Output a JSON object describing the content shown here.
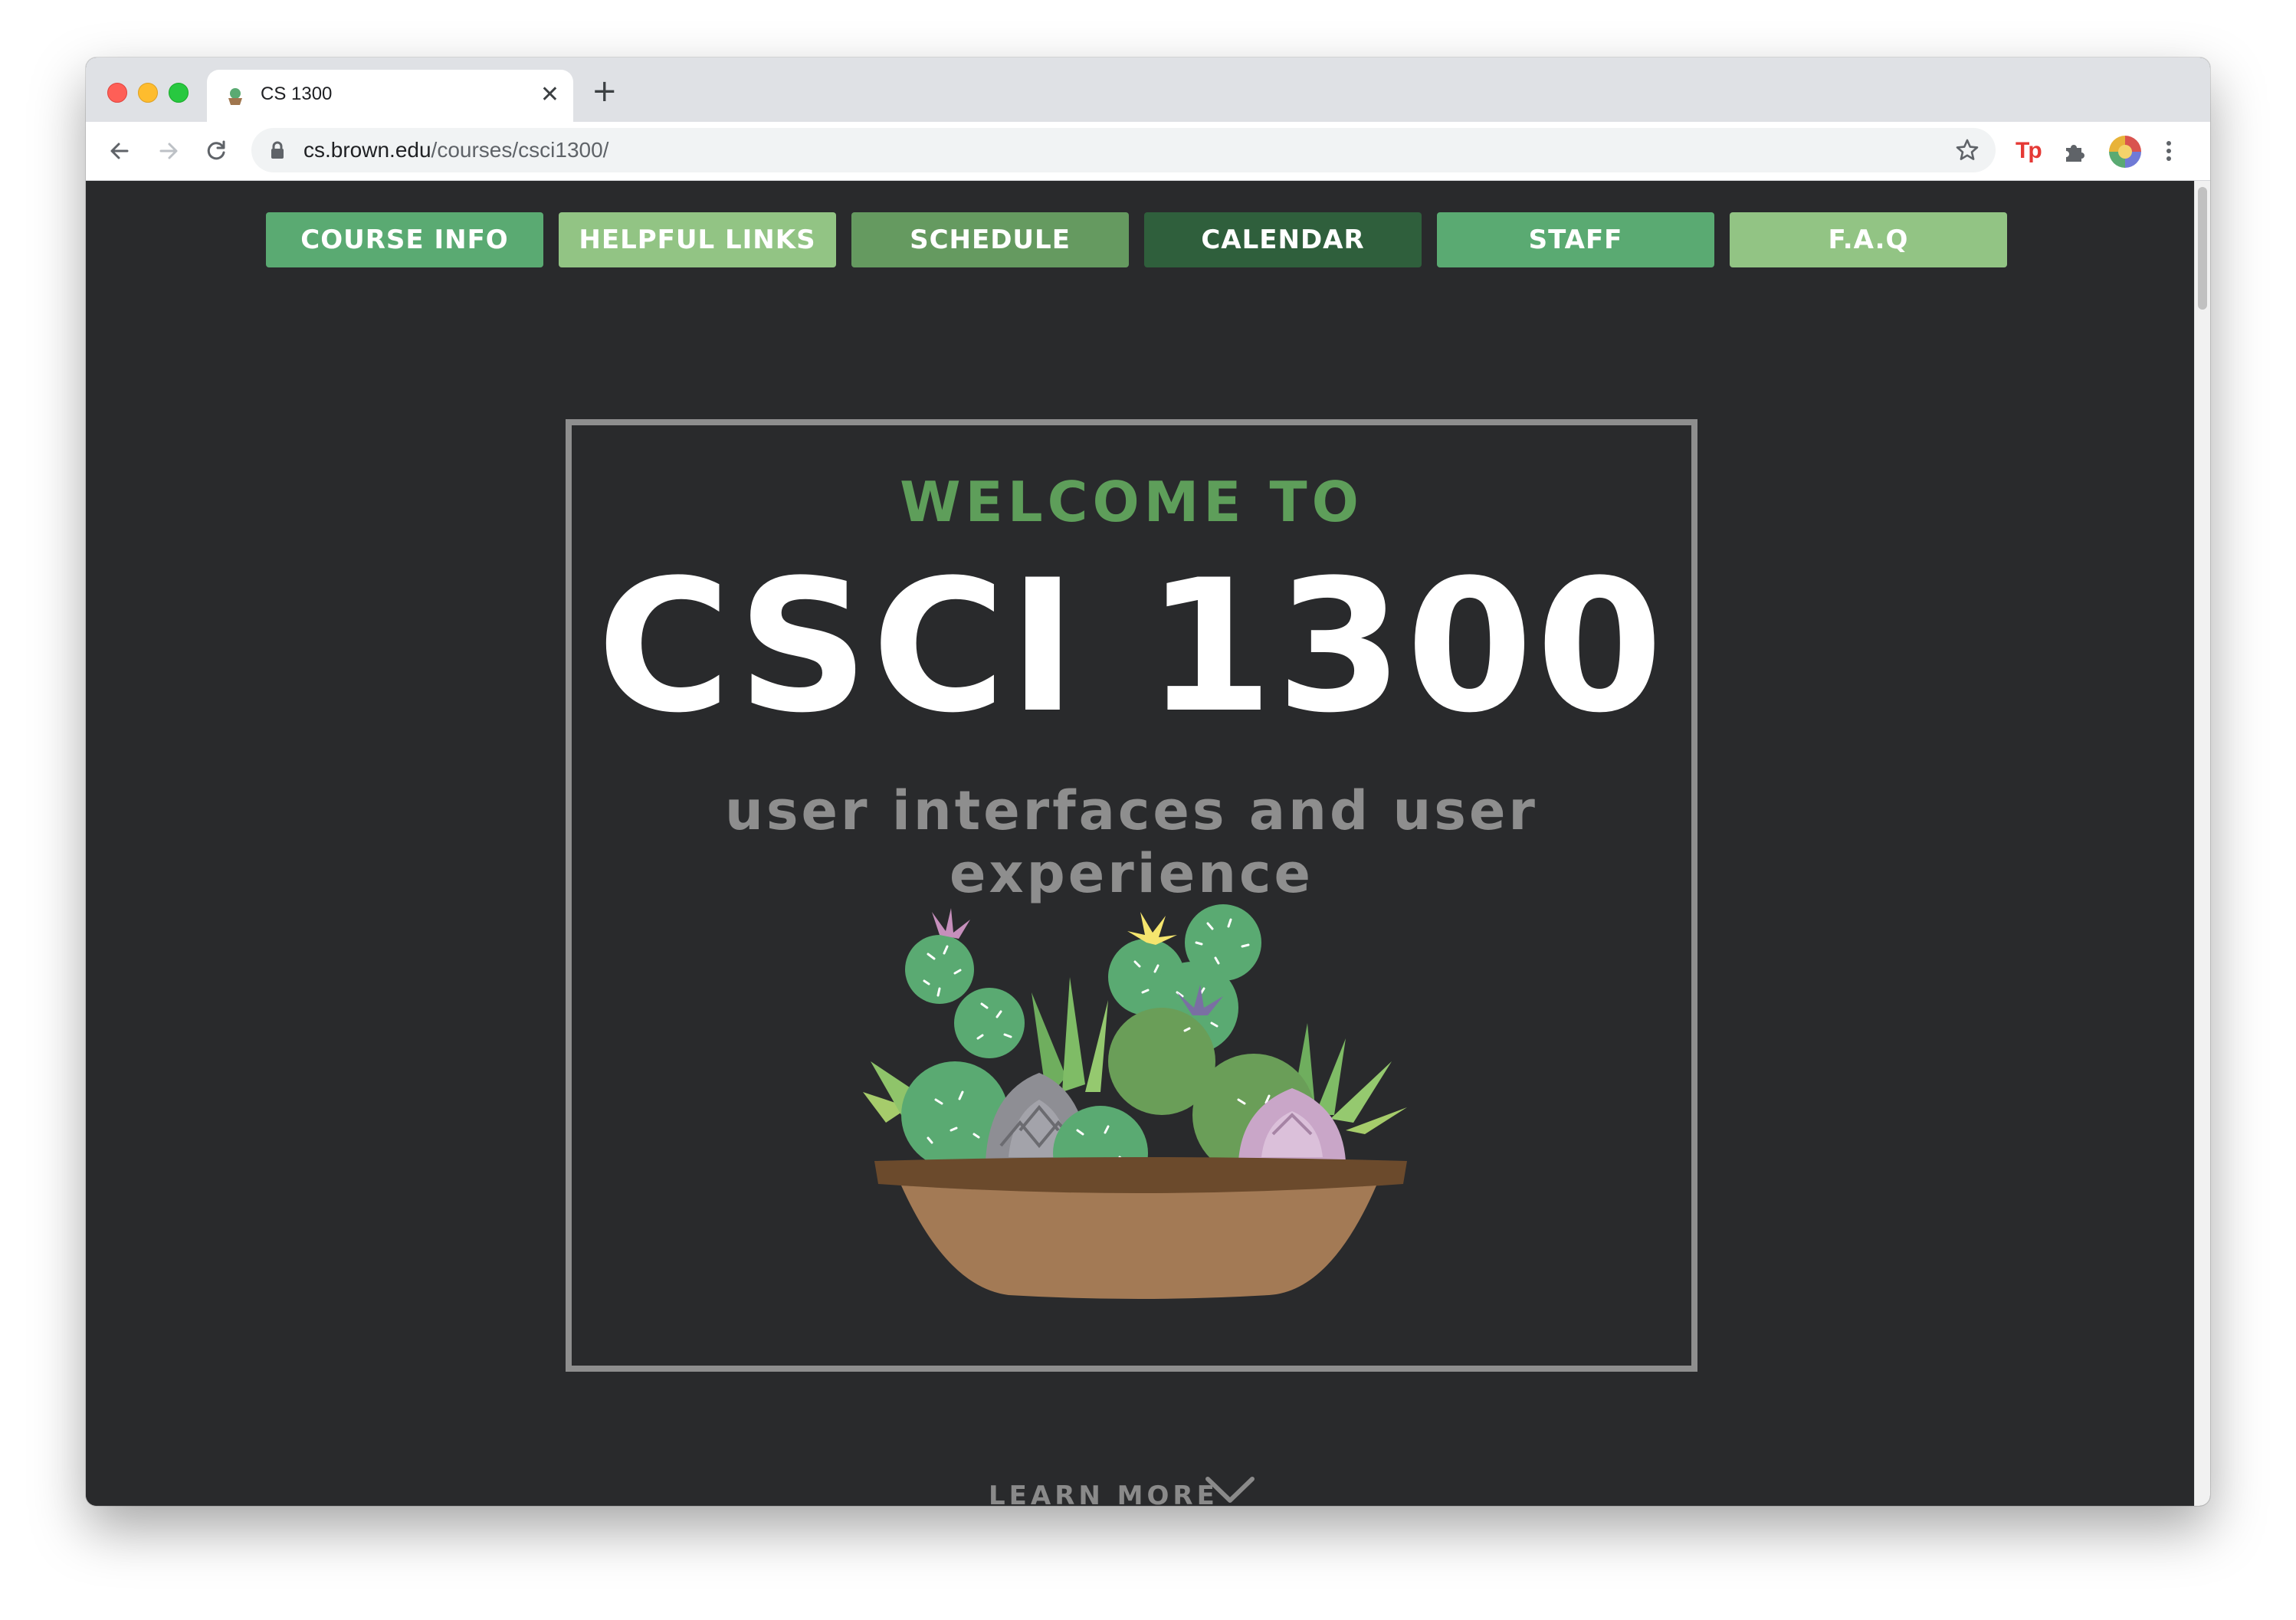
{
  "browser": {
    "tab_title": "CS 1300",
    "tab_close": "✕",
    "new_tab": "+",
    "url_host": "cs.brown.edu",
    "url_path": "/courses/csci1300/",
    "ext_label": "Tp"
  },
  "nav": {
    "items": [
      {
        "label": "COURSE INFO",
        "color": "#5aaa72"
      },
      {
        "label": "HELPFUL LINKS",
        "color": "#92c484"
      },
      {
        "label": "SCHEDULE",
        "color": "#659a60"
      },
      {
        "label": "CALENDAR",
        "color": "#2f5f3c"
      },
      {
        "label": "STAFF",
        "color": "#5aaa72"
      },
      {
        "label": "F.A.Q",
        "color": "#92c484"
      }
    ]
  },
  "hero": {
    "welcome": "WELCOME TO",
    "title": "CSCI 1300",
    "subtitle": "user interfaces and user experience",
    "illustration": "succulent-bowl-illustration"
  },
  "footer": {
    "learn_more": "LEARN MORE",
    "icon": "chevron-down-icon"
  },
  "colors": {
    "page_bg": "#292a2c",
    "frame": "#8e8e8e",
    "accent_green": "#5e9e5a"
  }
}
